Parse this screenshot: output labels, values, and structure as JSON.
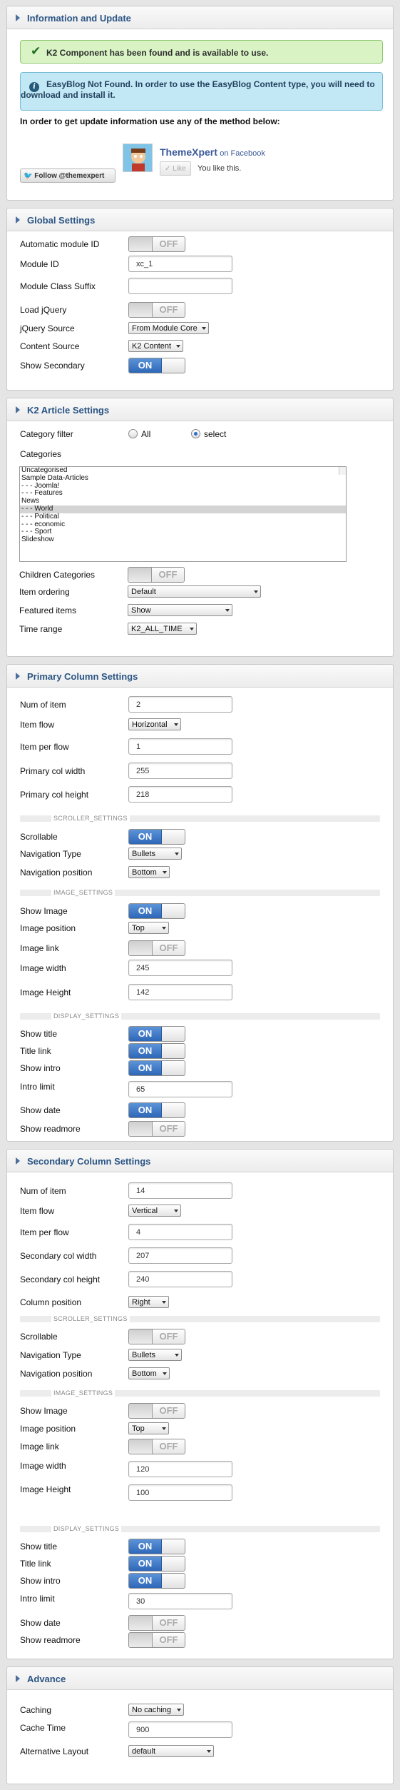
{
  "info_panel": {
    "title": "Information and Update",
    "success_msg": "K2 Component has been found and is available to use.",
    "notice_msg": "EasyBlog Not Found. In order to use the EasyBlog Content type, you will need to",
    "notice_link": "download and install it.",
    "update_text": "In order to get update information use any of the method below:",
    "twitter_follow": "Follow @themexpert",
    "fb_page": "ThemeXpert",
    "fb_on": "on Facebook",
    "fb_like": "Like",
    "fb_you_like": "You like this."
  },
  "global": {
    "title": "Global Settings",
    "auto_module_id": {
      "label": "Automatic module ID",
      "state": "OFF"
    },
    "module_id": {
      "label": "Module ID",
      "value": "xc_1"
    },
    "module_class_suffix": {
      "label": "Module Class Suffix",
      "value": ""
    },
    "load_jquery": {
      "label": "Load jQuery",
      "state": "OFF"
    },
    "jquery_source": {
      "label": "jQuery Source",
      "value": "From Module Core"
    },
    "content_source": {
      "label": "Content Source",
      "value": "K2 Content"
    },
    "show_secondary": {
      "label": "Show Secondary",
      "state": "ON"
    }
  },
  "k2": {
    "title": "K2 Article Settings",
    "category_filter": {
      "label": "Category filter",
      "opt_all": "All",
      "opt_select": "select",
      "selected": "select"
    },
    "categories_label": "Categories",
    "categories": [
      "Uncategorised",
      "Sample Data-Articles",
      "- - - Joomla!",
      "- - - Features",
      "News",
      "- - - World",
      "- - - Political",
      "- - - economic",
      "- - - Sport",
      "Slideshow"
    ],
    "selected_category": "- - - World",
    "children_categories": {
      "label": "Children Categories",
      "state": "OFF"
    },
    "item_ordering": {
      "label": "Item ordering",
      "value": "Default"
    },
    "featured_items": {
      "label": "Featured items",
      "value": "Show"
    },
    "time_range": {
      "label": "Time range",
      "value": "K2_ALL_TIME"
    }
  },
  "primary": {
    "title": "Primary Column Settings",
    "num_item": {
      "label": "Num of item",
      "value": "2"
    },
    "item_flow": {
      "label": "Item flow",
      "value": "Horizontal"
    },
    "item_per_flow": {
      "label": "Item per flow",
      "value": "1"
    },
    "col_width": {
      "label": "Primary col width",
      "value": "255"
    },
    "col_height": {
      "label": "Primary col height",
      "value": "218"
    },
    "scroller_heading": "SCROLLER_SETTINGS",
    "scrollable": {
      "label": "Scrollable",
      "state": "ON"
    },
    "nav_type": {
      "label": "Navigation Type",
      "value": "Bullets"
    },
    "nav_position": {
      "label": "Navigation position",
      "value": "Bottom"
    },
    "image_heading": "IMAGE_SETTINGS",
    "show_image": {
      "label": "Show Image",
      "state": "ON"
    },
    "image_position": {
      "label": "Image position",
      "value": "Top"
    },
    "image_link": {
      "label": "Image link",
      "state": "OFF"
    },
    "image_width": {
      "label": "Image width",
      "value": "245"
    },
    "image_height": {
      "label": "Image Height",
      "value": "142"
    },
    "display_heading": "DISPLAY_SETTINGS",
    "show_title": {
      "label": "Show title",
      "state": "ON"
    },
    "title_link": {
      "label": "Title link",
      "state": "ON"
    },
    "show_intro": {
      "label": "Show intro",
      "state": "ON"
    },
    "intro_limit": {
      "label": "Intro limit",
      "value": "65"
    },
    "show_date": {
      "label": "Show date",
      "state": "ON"
    },
    "show_readmore": {
      "label": "Show readmore",
      "state": "OFF"
    }
  },
  "secondary": {
    "title": "Secondary Column Settings",
    "num_item": {
      "label": "Num of item",
      "value": "14"
    },
    "item_flow": {
      "label": "Item flow",
      "value": "Vertical"
    },
    "item_per_flow": {
      "label": "Item per flow",
      "value": "4"
    },
    "col_width": {
      "label": "Secondary col width",
      "value": "207"
    },
    "col_height": {
      "label": "Secondary col height",
      "value": "240"
    },
    "column_position": {
      "label": "Column position",
      "value": "Right"
    },
    "scroller_heading": "SCROLLER_SETTINGS",
    "scrollable": {
      "label": "Scrollable",
      "state": "OFF"
    },
    "nav_type": {
      "label": "Navigation Type",
      "value": "Bullets"
    },
    "nav_position": {
      "label": "Navigation position",
      "value": "Bottom"
    },
    "image_heading": "IMAGE_SETTINGS",
    "show_image": {
      "label": "Show Image",
      "state": "OFF"
    },
    "image_position": {
      "label": "Image position",
      "value": "Top"
    },
    "image_link": {
      "label": "Image link",
      "state": "OFF"
    },
    "image_width": {
      "label": "Image width",
      "value": "120"
    },
    "image_height": {
      "label": "Image Height",
      "value": "100"
    },
    "display_heading": "DISPLAY_SETTINGS",
    "show_title": {
      "label": "Show title",
      "state": "ON"
    },
    "title_link": {
      "label": "Title link",
      "state": "ON"
    },
    "show_intro": {
      "label": "Show intro",
      "state": "ON"
    },
    "intro_limit": {
      "label": "Intro limit",
      "value": "30"
    },
    "show_date": {
      "label": "Show date",
      "state": "OFF"
    },
    "show_readmore": {
      "label": "Show readmore",
      "state": "OFF"
    }
  },
  "advance": {
    "title": "Advance",
    "caching": {
      "label": "Caching",
      "value": "No caching"
    },
    "cache_time": {
      "label": "Cache Time",
      "value": "900"
    },
    "alt_layout": {
      "label": "Alternative Layout",
      "value": "default"
    }
  },
  "colors": {
    "on": "#2e67b8",
    "header_text": "#2b5584",
    "success_bg": "#d9f3c5",
    "notice_bg": "#c3e8f5"
  }
}
